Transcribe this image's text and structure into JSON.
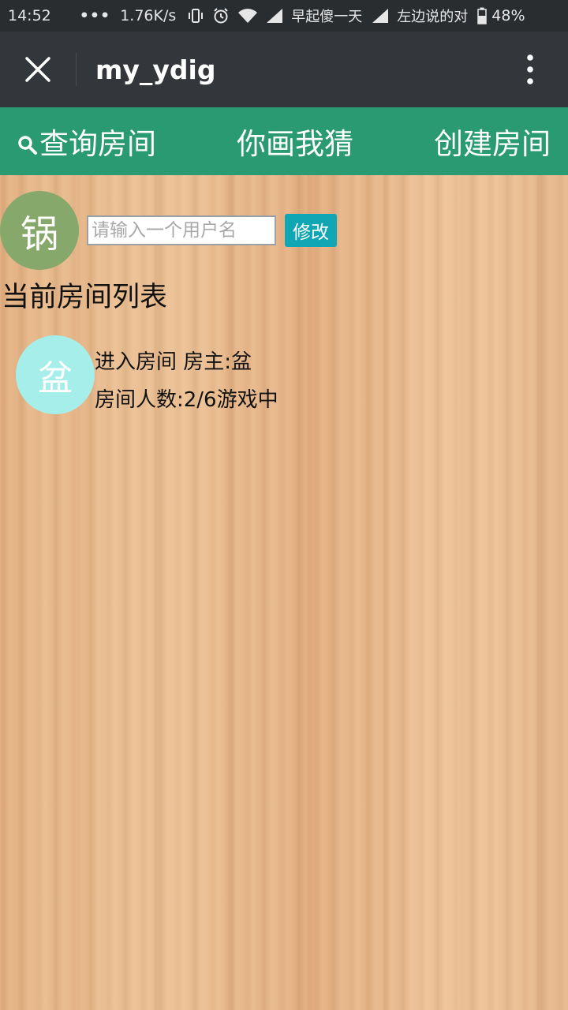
{
  "status_bar": {
    "time": "14:52",
    "dots": "•••",
    "speed": "1.76K/s",
    "carrier1": "早起傻一天",
    "carrier2": "左边说的对",
    "battery": "48%",
    "icons": [
      "vibrate-icon",
      "alarm-icon",
      "wifi-icon",
      "signal-icon",
      "signal-icon",
      "battery-icon"
    ]
  },
  "title_bar": {
    "title": "my_ydig",
    "close_icon": "close-icon",
    "more_icon": "more-vertical-icon"
  },
  "tabs": [
    {
      "label": "查询房间",
      "icon": "search-icon"
    },
    {
      "label": "你画我猜"
    },
    {
      "label": "创建房间"
    }
  ],
  "user": {
    "avatar_char": "锅",
    "name_value": "",
    "name_placeholder": "请输入一个用户名",
    "modify_label": "修改"
  },
  "room_list": {
    "title": "当前房间列表",
    "rooms": [
      {
        "avatar_char": "盆",
        "line1": "进入房间 房主:盆",
        "line2": "房间人数:2/6游戏中"
      }
    ]
  },
  "colors": {
    "status_bar_bg": "#2a2d30",
    "title_bar_bg": "#33363a",
    "tab_bar_bg": "#2a9a72",
    "modify_button_bg": "#10a6b4",
    "self_avatar_bg": "#86a86a",
    "room_avatar_bg": "#a6eeea",
    "wood_bg": "#e6b58a"
  }
}
